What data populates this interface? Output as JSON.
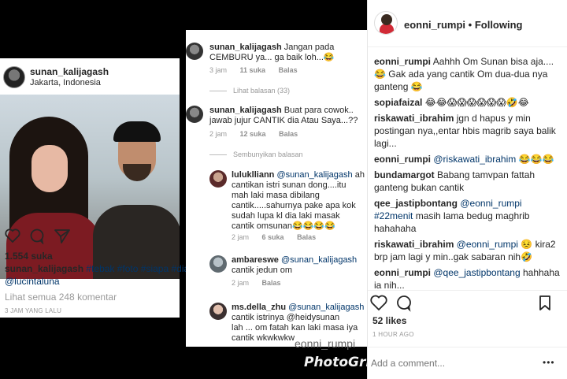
{
  "post1": {
    "username": "sunan_kalijagash",
    "location": "Jakarta, Indonesia",
    "likes": "1.554 suka",
    "caption_user": "sunan_kalijagash",
    "caption_tags_1": "#tebak #foto #siapa #dia",
    "caption_tags_2": "@lucintaluna",
    "view_all": "Lihat semua 248 komentar",
    "time": "3 JAM YANG LALU"
  },
  "post2": {
    "comments": [
      {
        "user": "sunan_kalijagash",
        "text1": "Jangan pada",
        "text2": "CEMBURU ya... ga baik loh...😂",
        "time": "3 jam",
        "likes": "11 suka",
        "reply": "Balas"
      },
      {
        "user": "sunan_kalijagash",
        "text1": "Buat para cowok..",
        "text2": "jawab jujur CANTIK dia Atau Saya...??",
        "time": "2 jam",
        "likes": "12 suka",
        "reply": "Balas"
      }
    ],
    "view_replies": "Lihat balasan (33)",
    "hide_replies": "Sembunyikan balasan",
    "replies": [
      {
        "user": "luluklliann",
        "mention": "@sunan_kalijagash",
        "lines": [
          "ah",
          "cantikan istri sunan dong....itu",
          "mah laki masa dibilang",
          "cantik.....sahurnya pake apa kok",
          "sudah lupa kl dia laki masak",
          "cantik  omsunan😂😂😂😂"
        ],
        "time": "2 jam",
        "likes": "6 suka",
        "reply": "Balas"
      },
      {
        "user": "ambareswe",
        "mention": "@sunan_kalijagash",
        "lines": [
          "cantik jedun om"
        ],
        "time": "2 jam",
        "likes": "",
        "reply": "Balas"
      },
      {
        "user": "ms.della_zhu",
        "mention": "@sunan_kalijagash",
        "lines": [
          "cantik istrinya @heidysunan",
          "lah ... om fatah kan laki masa iya",
          "cantik wkwkwkw"
        ]
      }
    ],
    "watermark_user": "eonni_rumpi",
    "watermark_app": "PhotoGrid"
  },
  "panel": {
    "username": "eonni_rumpi",
    "dot": "•",
    "follow": "Following",
    "comments": [
      {
        "user": "eonni_rumpi",
        "text": "Aahhh Om Sunan bisa aja.... 😂 Gak ada yang cantik Om dua-dua nya ganteng 😂"
      },
      {
        "user": "sopiafaizal",
        "text": "😂😂😱😱😱😱😱😱🤣😂"
      },
      {
        "user": "riskawati_ibrahim",
        "text": "jgn d hapus y min postingan nya,,entar hbis magrib saya balik lagi..."
      },
      {
        "user": "eonni_rumpi",
        "mention": "@riskawati_ibrahim",
        "text": " 😂😂😂"
      },
      {
        "user": "bundamargot",
        "text": "Babang tamvpan fattah ganteng bukan cantik"
      },
      {
        "user": "qee_jastipbontang",
        "mention": "@eonni_rumpi #22menit",
        "text": " masih lama bedug maghrib hahahaha"
      },
      {
        "user": "riskawati_ibrahim",
        "mention": "@eonni_rumpi",
        "text": " 😣 kira2 brp jam lagi y min..gak sabaran nih🤣"
      },
      {
        "user": "eonni_rumpi",
        "mention": "@qee_jastipbontang",
        "text": " hahhaha ia nih..."
      }
    ],
    "likes": "52 likes",
    "time": "1 HOUR AGO",
    "add_placeholder": "Add a comment...",
    "more": "•••"
  }
}
